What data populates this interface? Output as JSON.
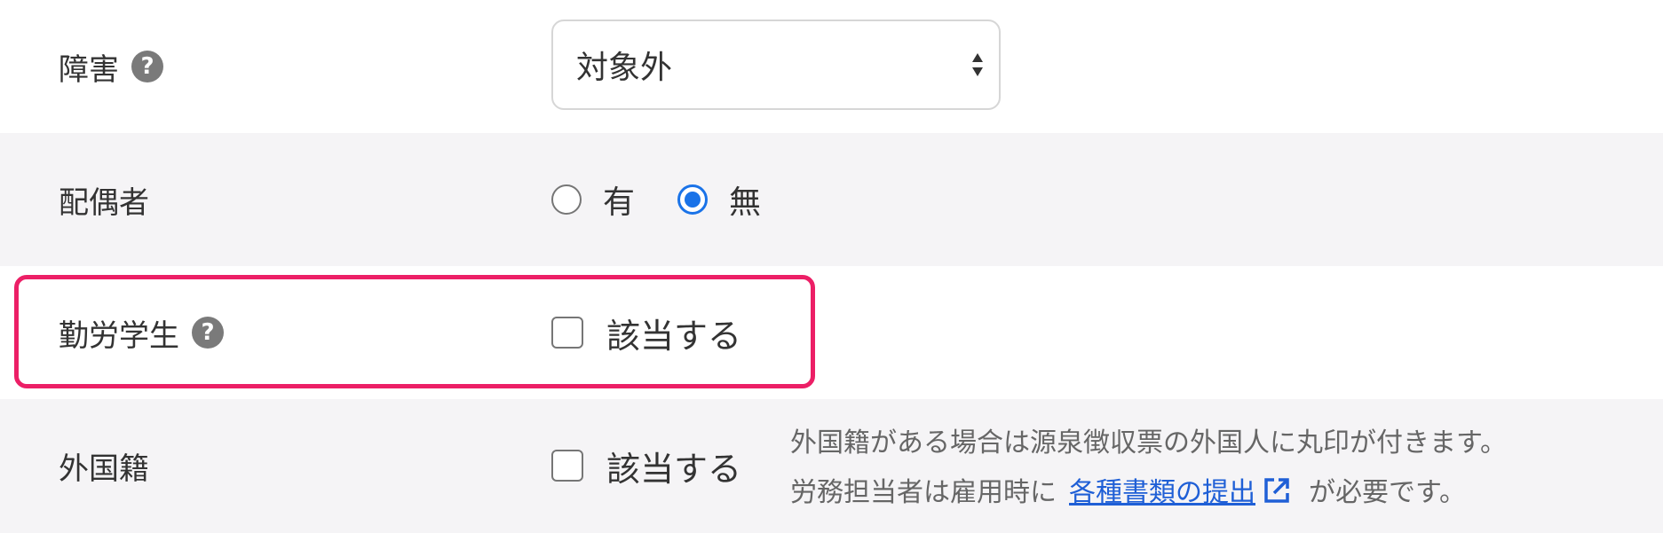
{
  "rows": {
    "disability": {
      "label": "障害",
      "help_icon": "question-circle-icon",
      "select_value": "対象外"
    },
    "spouse": {
      "label": "配偶者",
      "options": [
        "有",
        "無"
      ],
      "selected": "無"
    },
    "student": {
      "label": "勤労学生",
      "help_icon": "question-circle-icon",
      "checkbox_label": "該当する",
      "checked": false
    },
    "foreign": {
      "label": "外国籍",
      "checkbox_label": "該当する",
      "checked": false,
      "note_line1": "外国籍がある場合は源泉徴収票の外国人に丸印が付きます。",
      "note_line2_prefix": "労務担当者は雇用時に",
      "note_link": "各種書類の提出",
      "note_link_icon": "external-link-icon",
      "note_line2_suffix": "が必要です。"
    }
  },
  "colors": {
    "accent_blue": "#1a73e8",
    "highlight_pink": "#ec1f66",
    "link_blue": "#1f5fd6",
    "alt_row_bg": "#f5f4f6"
  }
}
